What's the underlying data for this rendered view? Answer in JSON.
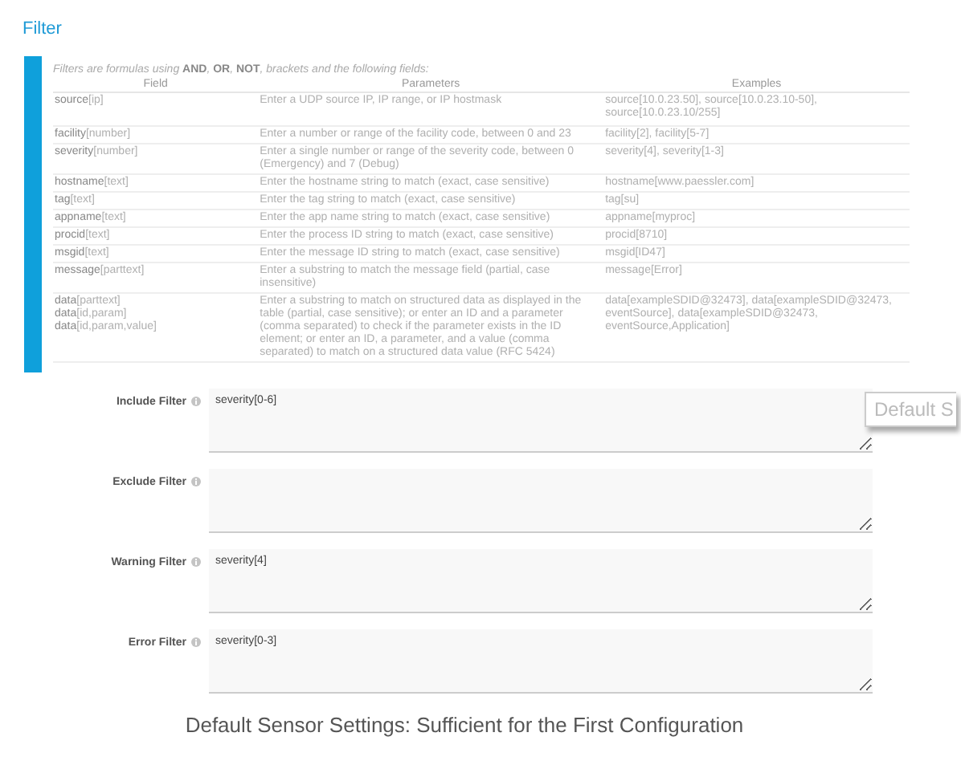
{
  "section_title": "Filter",
  "help": {
    "intro": "Filters are formulas using **AND**, **OR**, **NOT**, brackets and the following fields:",
    "columns": [
      "Field",
      "Parameters",
      "Examples"
    ],
    "rows": [
      {
        "field": [
          {
            "name": "source",
            "arg": "[ip]"
          }
        ],
        "parameters": "Enter a UDP source IP, IP range, or IP hostmask",
        "examples": "source[10.0.23.50], source[10.0.23.10-50], source[10.0.23.10/255]"
      },
      {
        "field": [
          {
            "name": "facility",
            "arg": "[number]"
          }
        ],
        "parameters": "Enter a number or range of the facility code, between 0 and 23",
        "examples": "facility[2], facility[5-7]"
      },
      {
        "field": [
          {
            "name": "severity",
            "arg": "[number]"
          }
        ],
        "parameters": "Enter a single number or range of the severity code, between 0 (Emergency) and 7 (Debug)",
        "examples": "severity[4], severity[1-3]"
      },
      {
        "field": [
          {
            "name": "hostname",
            "arg": "[text]"
          }
        ],
        "parameters": "Enter the hostname string to match (exact, case sensitive)",
        "examples": "hostname[www.paessler.com]"
      },
      {
        "field": [
          {
            "name": "tag",
            "arg": "[text]"
          }
        ],
        "parameters": "Enter the tag string to match (exact, case sensitive)",
        "examples": "tag[su]"
      },
      {
        "field": [
          {
            "name": "appname",
            "arg": "[text]"
          }
        ],
        "parameters": "Enter the app name string to match (exact, case sensitive)",
        "examples": "appname[myproc]"
      },
      {
        "field": [
          {
            "name": "procid",
            "arg": "[text]"
          }
        ],
        "parameters": "Enter the process ID string to match (exact, case sensitive)",
        "examples": "procid[8710]"
      },
      {
        "field": [
          {
            "name": "msgid",
            "arg": "[text]"
          }
        ],
        "parameters": "Enter the message ID string to match (exact, case sensitive)",
        "examples": "msgid[ID47]"
      },
      {
        "field": [
          {
            "name": "message",
            "arg": "[parttext]"
          }
        ],
        "parameters": "Enter a substring to match the message field (partial, case insensitive)",
        "examples": "message[Error]"
      },
      {
        "field": [
          {
            "name": "data",
            "arg": "[parttext]"
          },
          {
            "name": "data",
            "arg": "[id,param]"
          },
          {
            "name": "data",
            "arg": "[id,param,value]"
          }
        ],
        "parameters": "Enter a substring to match on structured data as displayed in the table (partial, case sensitive); or enter an ID and a parameter (comma separated) to check if the parameter exists in the ID element; or enter an ID, a parameter, and a value (comma separated) to match on a structured data value (RFC 5424)",
        "examples": "data[exampleSDID@32473], data[exampleSDID@32473, eventSource], data[exampleSDID@32473, eventSource,Application]"
      }
    ]
  },
  "filters": [
    {
      "label": "Include Filter",
      "value": "severity[0-6]"
    },
    {
      "label": "Exclude Filter"
    },
    {
      "label": "Warning Filter",
      "value": "severity[4]"
    },
    {
      "label": "Error Filter",
      "value": "severity[0-3]"
    }
  ],
  "tooltip": "Default S",
  "caption": "Default Sensor Settings: Sufficient for the First Configuration"
}
